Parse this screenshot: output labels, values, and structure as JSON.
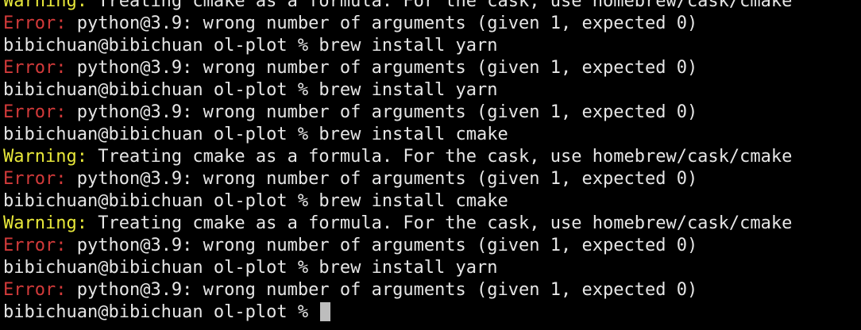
{
  "colors": {
    "background": "#000000",
    "text": "#e6e6e6",
    "warning": "#e8e83a",
    "error": "#d23a3a",
    "cursor": "#bdbdbd"
  },
  "lines": [
    {
      "type": "warning",
      "prefix": "Warning:",
      "text": " Treating cmake as a formula. For the cask, use homebrew/cask/cmake"
    },
    {
      "type": "error",
      "prefix": "Error:",
      "text": " python@3.9: wrong number of arguments (given 1, expected 0)"
    },
    {
      "type": "prompt",
      "prefix": "",
      "text": "bibichuan@bibichuan ol-plot % brew install yarn"
    },
    {
      "type": "error",
      "prefix": "Error:",
      "text": " python@3.9: wrong number of arguments (given 1, expected 0)"
    },
    {
      "type": "prompt",
      "prefix": "",
      "text": "bibichuan@bibichuan ol-plot % brew install yarn"
    },
    {
      "type": "error",
      "prefix": "Error:",
      "text": " python@3.9: wrong number of arguments (given 1, expected 0)"
    },
    {
      "type": "prompt",
      "prefix": "",
      "text": "bibichuan@bibichuan ol-plot % brew install cmake"
    },
    {
      "type": "warning",
      "prefix": "Warning:",
      "text": " Treating cmake as a formula. For the cask, use homebrew/cask/cmake"
    },
    {
      "type": "error",
      "prefix": "Error:",
      "text": " python@3.9: wrong number of arguments (given 1, expected 0)"
    },
    {
      "type": "prompt",
      "prefix": "",
      "text": "bibichuan@bibichuan ol-plot % brew install cmake"
    },
    {
      "type": "warning",
      "prefix": "Warning:",
      "text": " Treating cmake as a formula. For the cask, use homebrew/cask/cmake"
    },
    {
      "type": "error",
      "prefix": "Error:",
      "text": " python@3.9: wrong number of arguments (given 1, expected 0)"
    },
    {
      "type": "prompt",
      "prefix": "",
      "text": "bibichuan@bibichuan ol-plot % brew install yarn"
    },
    {
      "type": "error",
      "prefix": "Error:",
      "text": " python@3.9: wrong number of arguments (given 1, expected 0)"
    },
    {
      "type": "prompt",
      "prefix": "",
      "text": "bibichuan@bibichuan ol-plot % "
    }
  ]
}
